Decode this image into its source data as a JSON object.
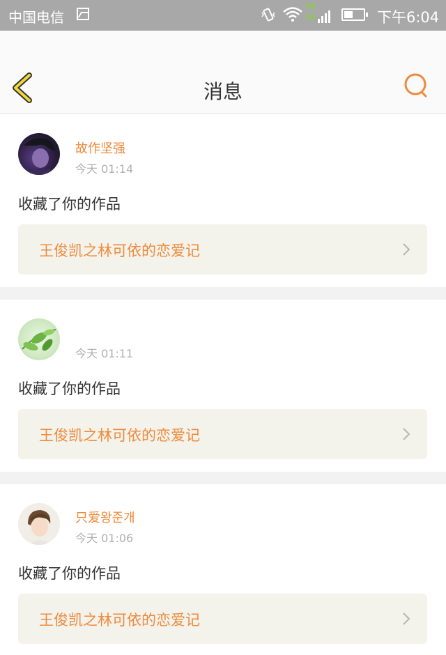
{
  "status_bar": {
    "carrier": "中国电信",
    "network_top": "3G",
    "network_bottom": "2G",
    "battery_level": 0.45,
    "time": "下午6:04"
  },
  "header": {
    "title": "消息",
    "back_icon": "chevron-left-icon",
    "search_icon": "search-icon"
  },
  "colors": {
    "accent": "#ef8a3c",
    "back_icon": "#f0d73a",
    "work_bg": "#f3f3ec"
  },
  "messages": [
    {
      "username": "故作坚强",
      "time": "今天 01:14",
      "action": "收藏了你的作品",
      "work_title": "王俊凯之林可依的恋爱记"
    },
    {
      "username": "",
      "time": "今天 01:11",
      "action": "收藏了你的作品",
      "work_title": "王俊凯之林可依的恋爱记"
    },
    {
      "username": "只爱왕준개",
      "time": "今天 01:06",
      "action": "收藏了你的作品",
      "work_title": "王俊凯之林可依的恋爱记"
    }
  ]
}
